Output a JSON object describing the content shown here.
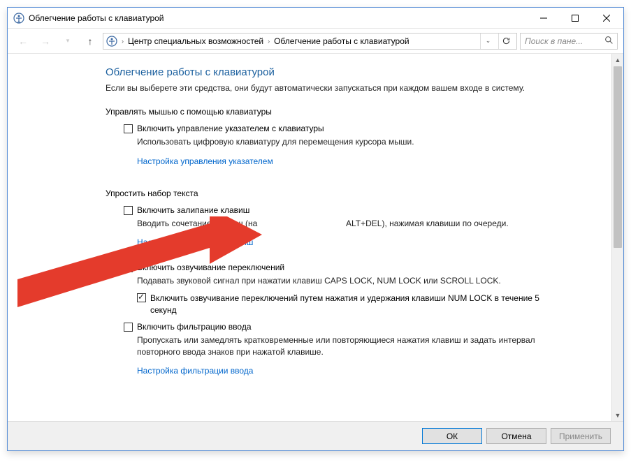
{
  "window": {
    "title": "Облегчение работы с клавиатурой"
  },
  "nav": {
    "breadcrumb1": "Центр специальных возможностей",
    "breadcrumb2": "Облегчение работы с клавиатурой",
    "search_placeholder": "Поиск в пане..."
  },
  "page": {
    "heading": "Облегчение работы с клавиатурой",
    "intro": "Если вы выберете эти средства, они будут автоматически запускаться при каждом вашем входе в систему."
  },
  "section_mouse": {
    "title": "Управлять мышью с помощью клавиатуры",
    "enable_pointer": "Включить управление указателем с клавиатуры",
    "enable_pointer_desc": "Использовать цифровую клавиатуру для перемещения курсора мыши.",
    "link": "Настройка управления указателем"
  },
  "section_typing": {
    "title": "Упростить набор текста",
    "sticky": "Включить залипание клавиш",
    "sticky_desc_pre": "Вводить сочетание клавиш (на",
    "sticky_desc_post": "ALT+DEL), нажимая клавиши по очереди.",
    "sticky_link": "Настройка залипания клавиш",
    "toggle": "Включить озвучивание переключений",
    "toggle_desc": "Подавать звуковой сигнал при нажатии клавиш CAPS LOCK, NUM LOCK или SCROLL LOCK.",
    "toggle_numlock": "Включить озвучивание переключений путем нажатия и удержания клавиши NUM LOCK в течение 5 секунд",
    "filter": "Включить фильтрацию ввода",
    "filter_desc": "Пропускать или замедлять кратковременные или повторяющиеся нажатия клавиш и задать интервал повторного ввода знаков при нажатой клавише.",
    "filter_link": "Настройка фильтрации ввода"
  },
  "footer": {
    "ok": "ОК",
    "cancel": "Отмена",
    "apply": "Применить"
  }
}
